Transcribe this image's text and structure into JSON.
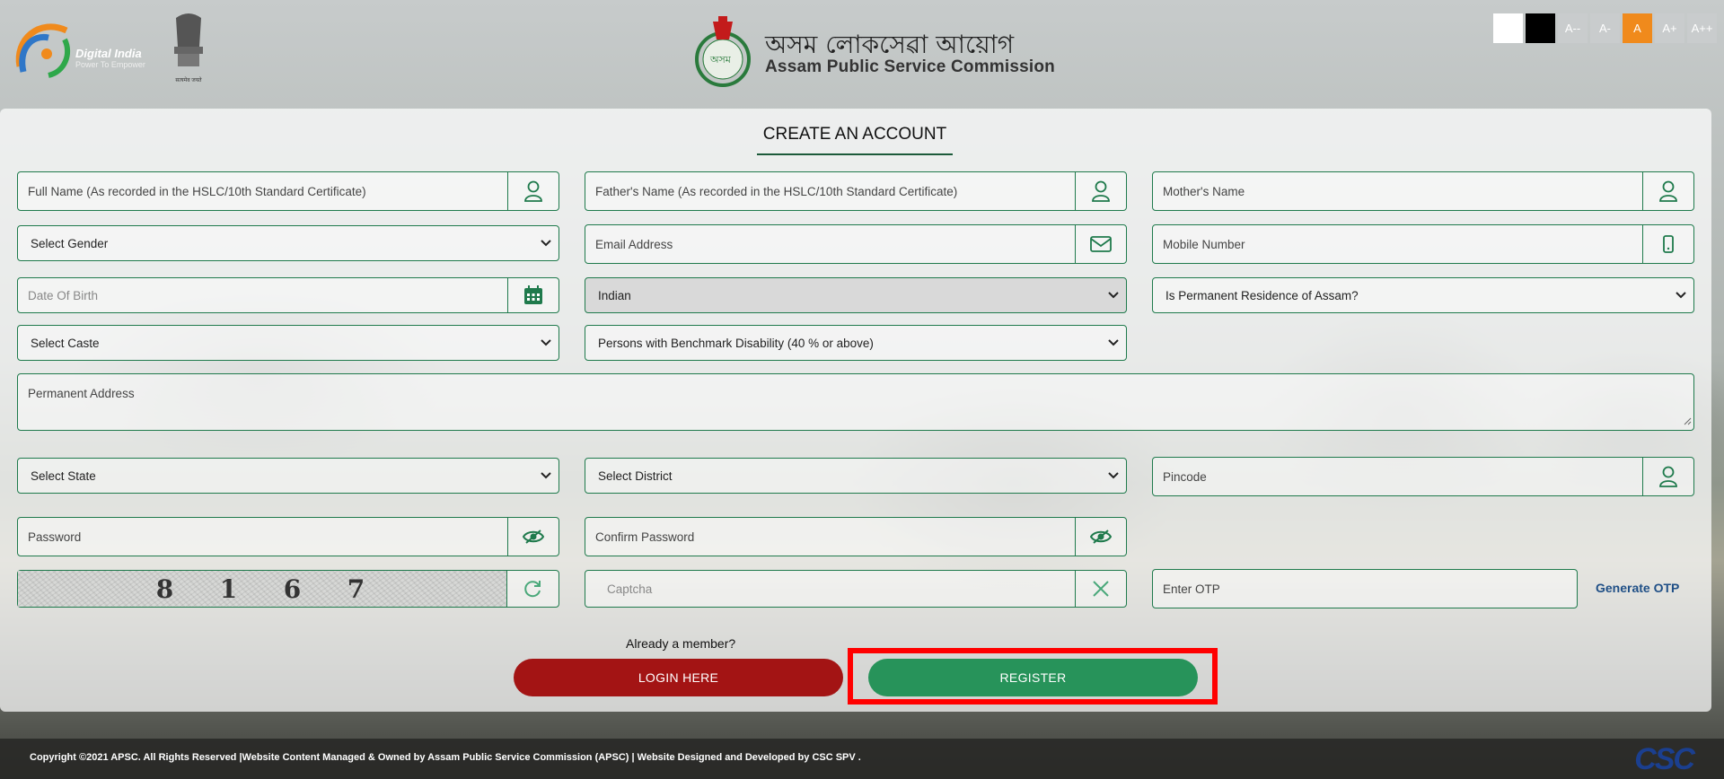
{
  "header": {
    "digital_india_title": "Digital India",
    "digital_india_tagline": "Power To Empower",
    "emblem_caption": "सत्यमेव जयते",
    "apsc_title_assamese": "অসম লোকসেৱা আয়োগ",
    "apsc_title_english": "Assam Public Service Commission",
    "apsc_logo_text": "অসম"
  },
  "accessibility": {
    "font_buttons": [
      "A--",
      "A-",
      "A",
      "A+",
      "A++"
    ],
    "selected": "A"
  },
  "form": {
    "title": "CREATE AN ACCOUNT",
    "full_name_placeholder": "Full Name (As recorded in the HSLC/10th Standard Certificate)",
    "father_name_placeholder": "Father's Name (As recorded in the HSLC/10th Standard Certificate)",
    "mother_name_placeholder": "Mother's Name",
    "gender_select": "Select Gender",
    "email_placeholder": "Email Address",
    "mobile_placeholder": "Mobile Number",
    "dob_placeholder": "Date Of Birth",
    "nationality_select": "Indian",
    "permanent_resident_select": "Is Permanent Residence of Assam?",
    "caste_select": "Select Caste",
    "disability_select": "Persons with Benchmark Disability (40 % or above)",
    "address_placeholder": "Permanent Address",
    "state_select": "Select State",
    "district_select": "Select District",
    "pincode_placeholder": "Pincode",
    "password_placeholder": "Password",
    "confirm_password_placeholder": "Confirm Password",
    "captcha_digits": [
      "8",
      "1",
      "6",
      "7"
    ],
    "captcha_placeholder": "Captcha",
    "otp_placeholder": "Enter OTP",
    "generate_otp": "Generate OTP",
    "already_member": "Already a member?",
    "login_button": "LOGIN HERE",
    "register_button": "REGISTER"
  },
  "footer": {
    "text": "Copyright ©2021 APSC. All Rights Reserved |Website Content Managed & Owned by Assam Public Service Commission (APSC) | Website Designed and Developed by CSC SPV .",
    "csc_logo": "CSC"
  },
  "colors": {
    "accent_green": "#1f7a4c",
    "register_green": "#27935a",
    "login_red": "#a31414",
    "highlight_red": "#ff0000",
    "font_size_selected": "#f08a1c"
  }
}
